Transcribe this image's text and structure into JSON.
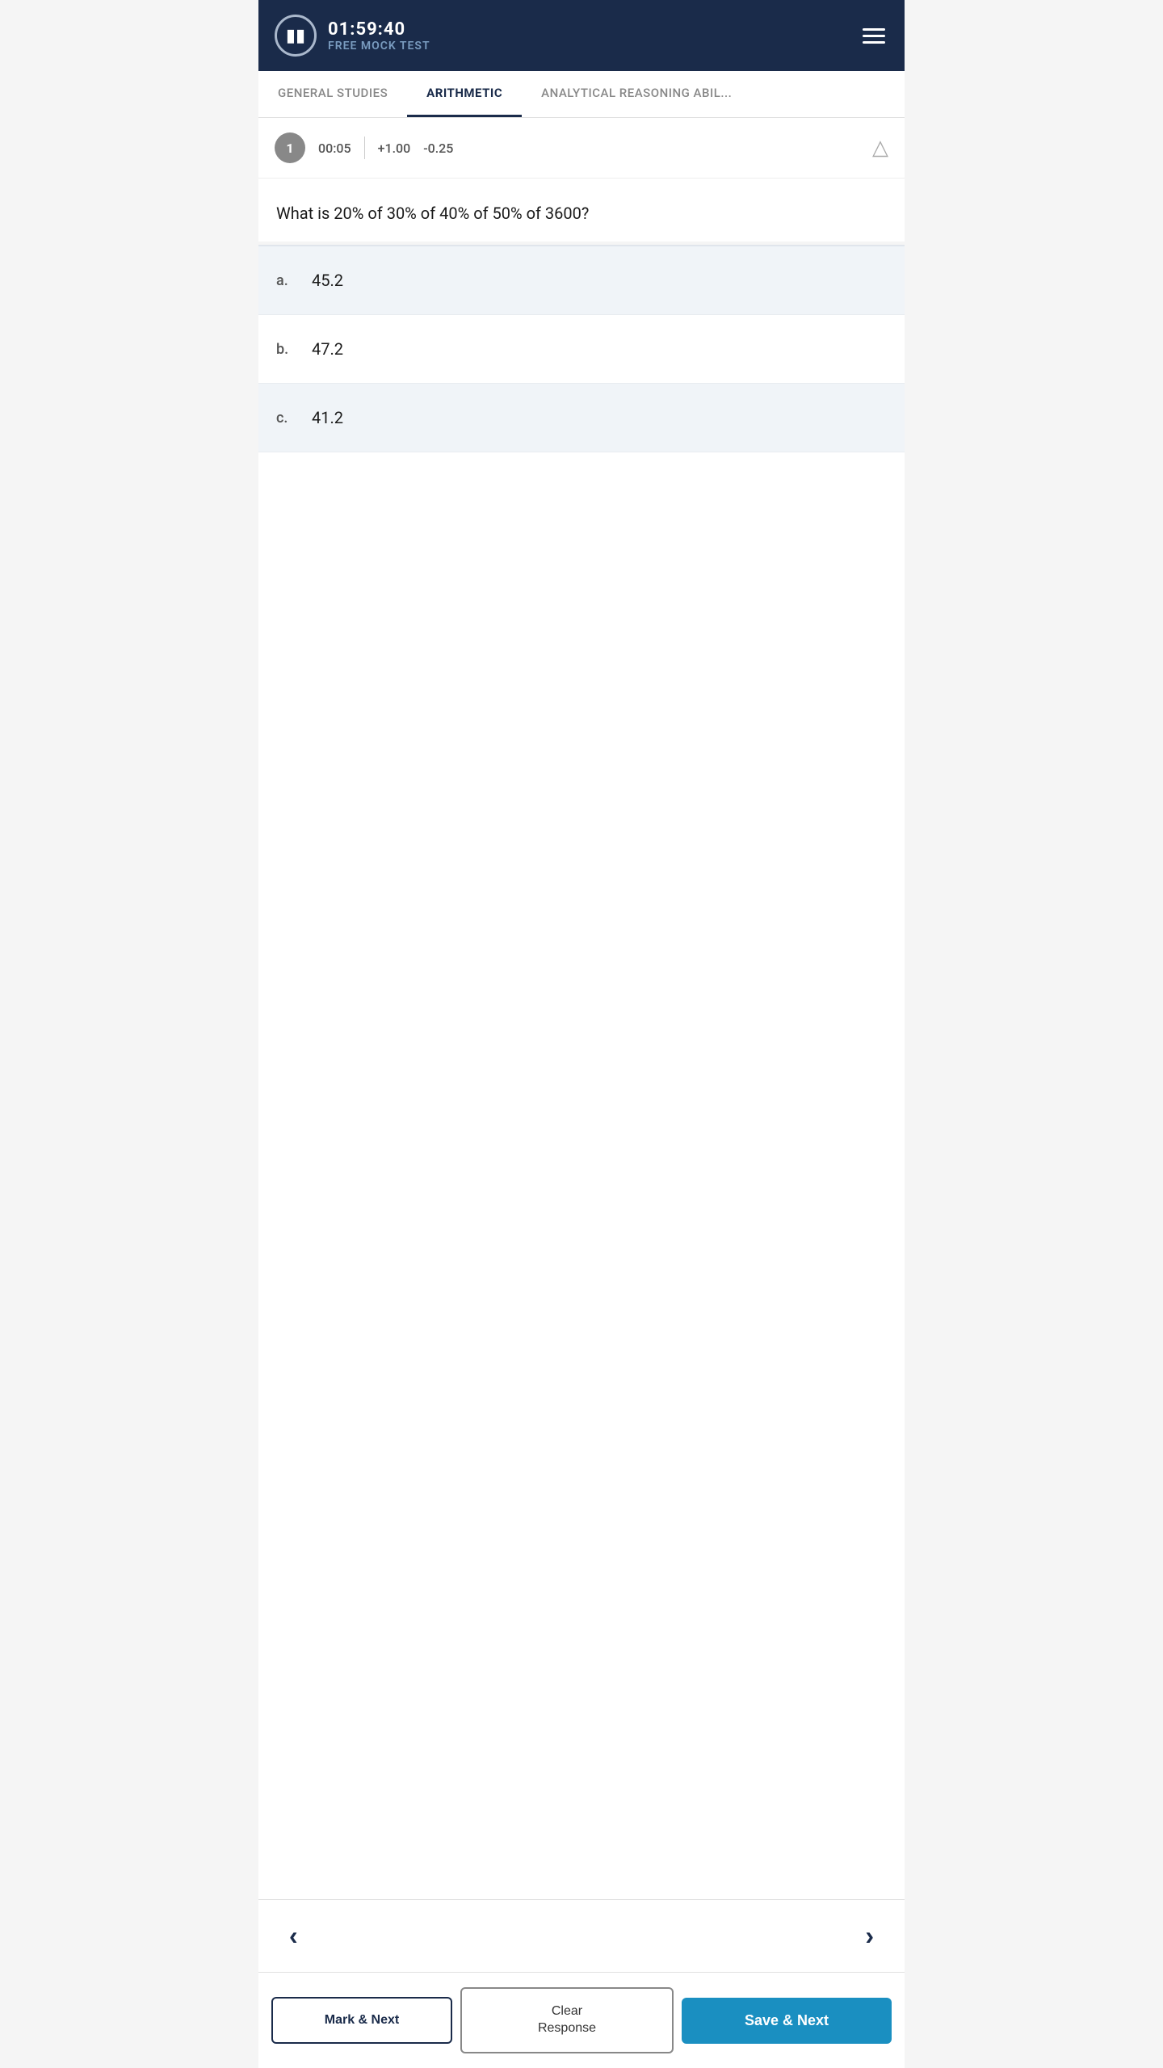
{
  "header": {
    "timer": "01:59:40",
    "test_name": "FREE MOCK TEST",
    "pause_label": "⏸",
    "hamburger_label": "≡"
  },
  "tabs": [
    {
      "id": "general-studies",
      "label": "GENERAL STUDIES",
      "active": false
    },
    {
      "id": "arithmetic",
      "label": "Arithmetic",
      "active": true
    },
    {
      "id": "analytical",
      "label": "Analytical Reasoning Abil...",
      "active": false
    }
  ],
  "question_info": {
    "number": "1",
    "time": "00:05",
    "marks_positive": "+1.00",
    "marks_negative": "-0.25",
    "warning_icon": "⚠"
  },
  "question": {
    "text": "What is 20% of 30% of 40% of 50% of 3600?"
  },
  "options": [
    {
      "label": "a.",
      "value": "45.2"
    },
    {
      "label": "b.",
      "value": "47.2"
    },
    {
      "label": "c.",
      "value": "41.2"
    }
  ],
  "navigation": {
    "prev_icon": "‹",
    "next_icon": "›"
  },
  "buttons": {
    "mark_next": "Mark & Next",
    "clear_response_line1": "Clear",
    "clear_response_line2": "Response",
    "save_next": "Save & Next"
  }
}
